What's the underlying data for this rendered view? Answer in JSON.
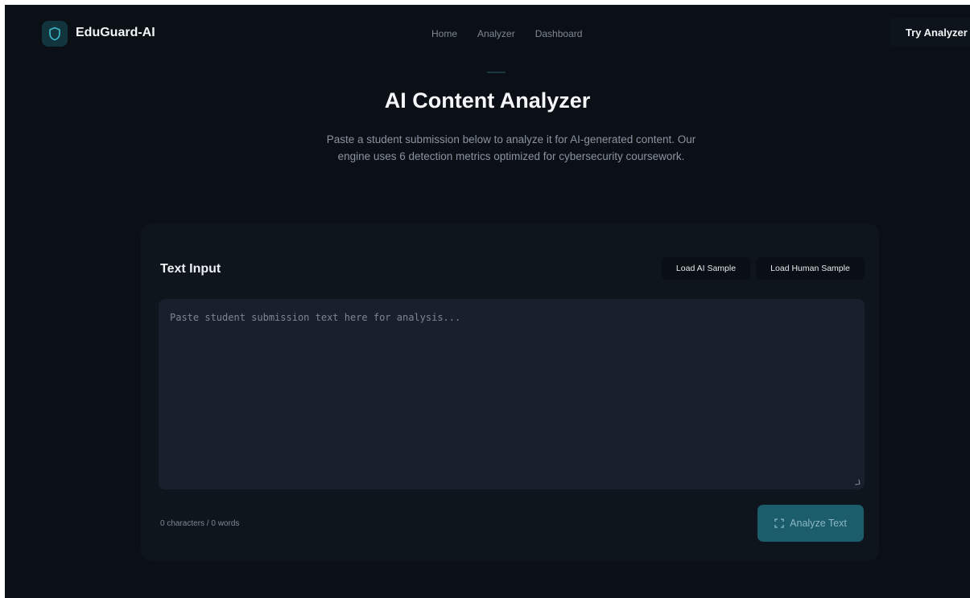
{
  "navbar": {
    "brand": "EduGuard-AI",
    "logo_icon": "shield-icon",
    "links": [
      {
        "label": "Home",
        "active": false
      },
      {
        "label": "Analyzer",
        "active": true
      },
      {
        "label": "Dashboard",
        "active": false
      }
    ],
    "cta_label": "Try Analyzer"
  },
  "hero": {
    "title": "AI Content Analyzer",
    "subtitle": "Paste a student submission below to analyze it for AI-generated content. Our engine uses 6 detection metrics optimized for cybersecurity coursework."
  },
  "input_card": {
    "title": "Text Input",
    "load_ai_sample_label": "Load AI Sample",
    "load_human_sample_label": "Load Human Sample",
    "textarea_value": "",
    "textarea_placeholder": "Paste student submission text here for analysis...",
    "char_count": "0 characters / 0 words",
    "analyze_label": "Analyze Text",
    "analyze_icon": "scan-icon"
  },
  "colors": {
    "background": "#0b1017",
    "card": "#0f151d",
    "accent": "#1c5d6c",
    "text_primary": "#f4f6f8",
    "text_muted": "#8b93a0"
  }
}
